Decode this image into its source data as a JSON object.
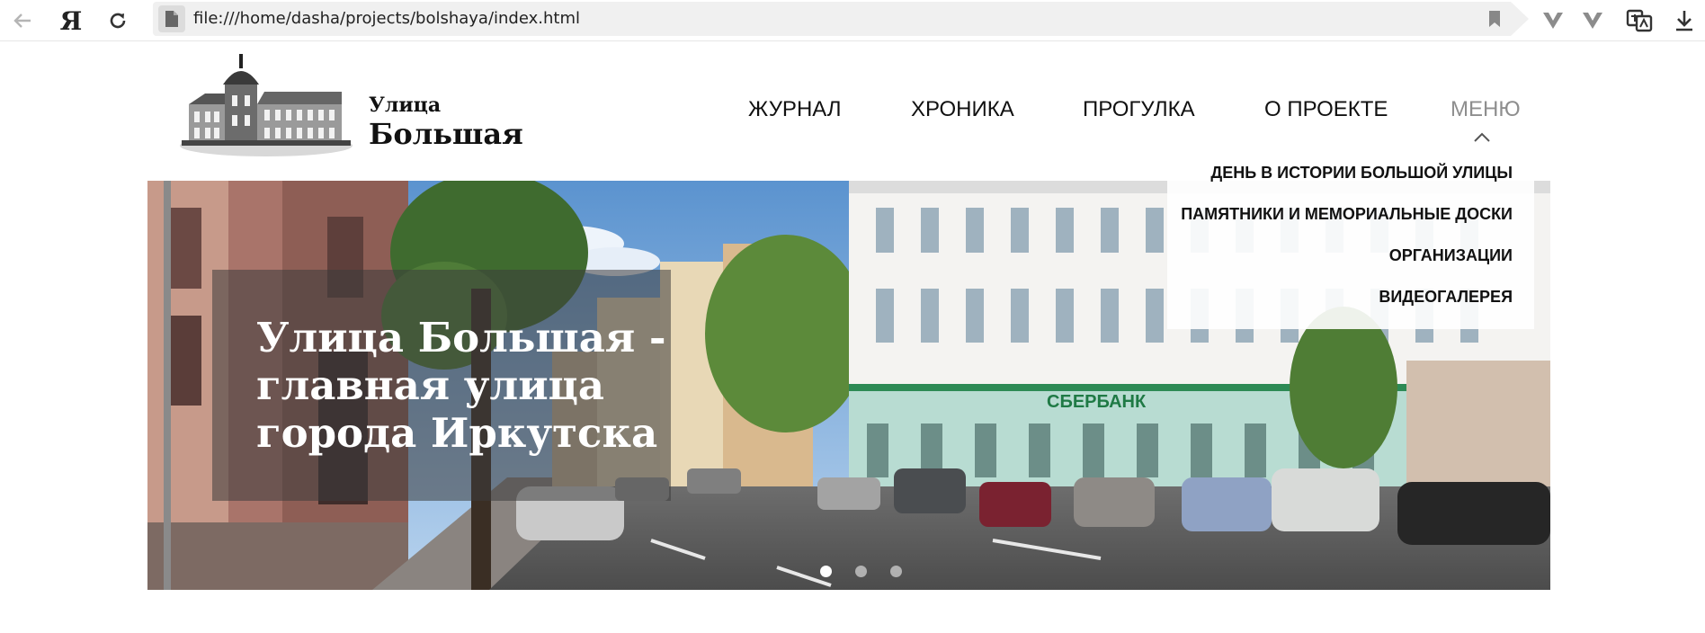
{
  "browser": {
    "url": "file:///home/dasha/projects/bolshaya/index.html",
    "logo_letter": "Я",
    "icons": [
      "back-arrow-icon",
      "yandex-logo-icon",
      "reload-icon",
      "file-icon",
      "bookmark-icon",
      "extension-v-icon",
      "extension-v-icon",
      "translate-icon",
      "download-icon"
    ]
  },
  "site": {
    "logo": {
      "line1": "Улица",
      "line2": "Большая"
    },
    "nav": [
      {
        "label": "ЖУРНАЛ"
      },
      {
        "label": "ХРОНИКА"
      },
      {
        "label": "ПРОГУЛКА"
      },
      {
        "label": "О ПРОЕКТЕ"
      },
      {
        "label": "МЕНЮ",
        "expanded": true
      }
    ],
    "menu_dropdown": [
      {
        "label": "ДЕНЬ В ИСТОРИИ БОЛЬШОЙ УЛИЦЫ"
      },
      {
        "label": "ПАМЯТНИКИ И МЕМОРИАЛЬНЫЕ ДОСКИ"
      },
      {
        "label": "ОРГАНИЗАЦИИ"
      },
      {
        "label": "ВИДЕОГАЛЕРЕЯ"
      }
    ],
    "hero": {
      "title": "Улица Большая - главная улица города Иркутска",
      "sign": "СБЕРБАНК",
      "slides_total": 3,
      "active_slide": 1
    }
  },
  "colors": {
    "text": "#111111",
    "muted_nav": "#8e8e8e",
    "overlay": "#3c3c3c"
  }
}
